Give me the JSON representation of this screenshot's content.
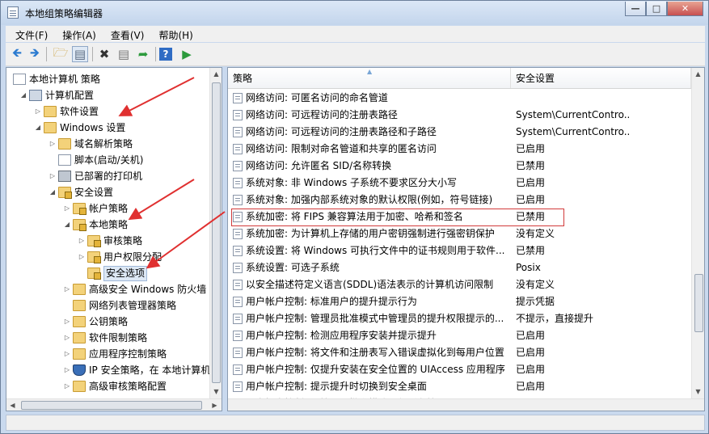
{
  "window": {
    "title": "本地组策略编辑器"
  },
  "menu": [
    "文件(F)",
    "操作(A)",
    "查看(V)",
    "帮助(H)"
  ],
  "tree": [
    {
      "label": "本地计算机 策略",
      "level": 0,
      "exp": "",
      "icon": "policy"
    },
    {
      "label": "计算机配置",
      "level": 1,
      "exp": "open",
      "icon": "computer"
    },
    {
      "label": "软件设置",
      "level": 2,
      "exp": "closed",
      "icon": "folder"
    },
    {
      "label": "Windows 设置",
      "level": 2,
      "exp": "open",
      "icon": "folder"
    },
    {
      "label": "域名解析策略",
      "level": 3,
      "exp": "closed",
      "icon": "folder"
    },
    {
      "label": "脚本(启动/关机)",
      "level": 3,
      "exp": "",
      "icon": "script"
    },
    {
      "label": "已部署的打印机",
      "level": 3,
      "exp": "closed",
      "icon": "printer"
    },
    {
      "label": "安全设置",
      "level": 3,
      "exp": "open",
      "icon": "lockfolder"
    },
    {
      "label": "帐户策略",
      "level": 4,
      "exp": "closed",
      "icon": "lockfolder"
    },
    {
      "label": "本地策略",
      "level": 4,
      "exp": "open",
      "icon": "lockfolder"
    },
    {
      "label": "审核策略",
      "level": 5,
      "exp": "closed",
      "icon": "lockfolder"
    },
    {
      "label": "用户权限分配",
      "level": 5,
      "exp": "closed",
      "icon": "lockfolder"
    },
    {
      "label": "安全选项",
      "level": 5,
      "exp": "",
      "icon": "lockfolder",
      "selected": true
    },
    {
      "label": "高级安全 Windows 防火墙",
      "level": 4,
      "exp": "closed",
      "icon": "folder"
    },
    {
      "label": "网络列表管理器策略",
      "level": 4,
      "exp": "",
      "icon": "folder"
    },
    {
      "label": "公钥策略",
      "level": 4,
      "exp": "closed",
      "icon": "folder"
    },
    {
      "label": "软件限制策略",
      "level": 4,
      "exp": "closed",
      "icon": "folder"
    },
    {
      "label": "应用程序控制策略",
      "level": 4,
      "exp": "closed",
      "icon": "folder"
    },
    {
      "label": "IP 安全策略，在 本地计算机",
      "level": 4,
      "exp": "closed",
      "icon": "shield"
    },
    {
      "label": "高级审核策略配置",
      "level": 4,
      "exp": "closed",
      "icon": "folder"
    }
  ],
  "list": {
    "headers": [
      "策略",
      "安全设置"
    ],
    "rows": [
      [
        "网络访问: 可匿名访问的命名管道",
        ""
      ],
      [
        "网络访问: 可远程访问的注册表路径",
        "System\\CurrentContro..."
      ],
      [
        "网络访问: 可远程访问的注册表路径和子路径",
        "System\\CurrentContro..."
      ],
      [
        "网络访问: 限制对命名管道和共享的匿名访问",
        "已启用"
      ],
      [
        "网络访问: 允许匿名 SID/名称转换",
        "已禁用"
      ],
      [
        "系统对象: 非 Windows 子系统不要求区分大小写",
        "已启用"
      ],
      [
        "系统对象: 加强内部系统对象的默认权限(例如，符号链接)",
        "已启用"
      ],
      [
        "系统加密: 将 FIPS 兼容算法用于加密、哈希和签名",
        "已禁用"
      ],
      [
        "系统加密: 为计算机上存储的用户密钥强制进行强密钥保护",
        "没有定义"
      ],
      [
        "系统设置: 将 Windows 可执行文件中的证书规则用于软件...",
        "已禁用"
      ],
      [
        "系统设置: 可选子系统",
        "Posix"
      ],
      [
        "以安全描述符定义语言(SDDL)语法表示的计算机访问限制",
        "没有定义"
      ],
      [
        "用户帐户控制: 标准用户的提升提示行为",
        "提示凭据"
      ],
      [
        "用户帐户控制: 管理员批准模式中管理员的提升权限提示的...",
        "不提示，直接提升"
      ],
      [
        "用户帐户控制: 检测应用程序安装并提示提升",
        "已启用"
      ],
      [
        "用户帐户控制: 将文件和注册表写入错误虚拟化到每用户位置",
        "已启用"
      ],
      [
        "用户帐户控制: 仅提升安装在安全位置的 UIAccess 应用程序",
        "已启用"
      ],
      [
        "用户帐户控制: 提示提升时切换到安全桌面",
        "已启用"
      ],
      [
        "用户帐户控制: 以管理员批准模式运行所有管理员",
        "已禁用"
      ]
    ],
    "highlighted_row": 7
  },
  "colors": {
    "highlight": "#d23a3a",
    "arrow": "#e03030"
  }
}
